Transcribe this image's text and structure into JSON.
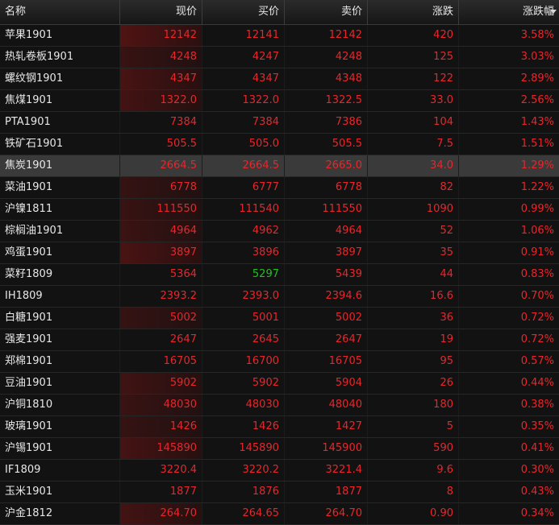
{
  "columns": [
    "名称",
    "现价",
    "买价",
    "卖价",
    "涨跌",
    "涨跌幅"
  ],
  "sorted_column": "涨跌幅",
  "colors": {
    "up": "#e8262b",
    "down": "#1fc21f",
    "flash": "#5a1010"
  },
  "rows": [
    {
      "name": "苹果1901",
      "last": "12142",
      "bid": "12141",
      "ask": "12142",
      "chg": "420",
      "pct": "3.58%",
      "flash": 0.95
    },
    {
      "name": "热轧卷板1901",
      "last": "4248",
      "bid": "4247",
      "ask": "4248",
      "chg": "125",
      "pct": "3.03%",
      "flash": 0.35
    },
    {
      "name": "螺纹钢1901",
      "last": "4347",
      "bid": "4347",
      "ask": "4348",
      "chg": "122",
      "pct": "2.89%",
      "flash": 0.75
    },
    {
      "name": "焦煤1901",
      "last": "1322.0",
      "bid": "1322.0",
      "ask": "1322.5",
      "chg": "33.0",
      "pct": "2.56%",
      "flash": 0.65
    },
    {
      "name": "PTA1901",
      "last": "7384",
      "bid": "7384",
      "ask": "7386",
      "chg": "104",
      "pct": "1.43%",
      "flash": 0
    },
    {
      "name": "铁矿石1901",
      "last": "505.5",
      "bid": "505.0",
      "ask": "505.5",
      "chg": "7.5",
      "pct": "1.51%",
      "flash": 0
    },
    {
      "name": "焦炭1901",
      "last": "2664.5",
      "bid": "2664.5",
      "ask": "2665.0",
      "chg": "34.0",
      "pct": "1.29%",
      "flash": 0,
      "selected": true
    },
    {
      "name": "菜油1901",
      "last": "6778",
      "bid": "6777",
      "ask": "6778",
      "chg": "82",
      "pct": "1.22%",
      "flash": 0.3
    },
    {
      "name": "沪镍1811",
      "last": "111550",
      "bid": "111540",
      "ask": "111550",
      "chg": "1090",
      "pct": "0.99%",
      "flash": 0.35
    },
    {
      "name": "棕榈油1901",
      "last": "4964",
      "bid": "4962",
      "ask": "4964",
      "chg": "52",
      "pct": "1.06%",
      "flash": 0.45
    },
    {
      "name": "鸡蛋1901",
      "last": "3897",
      "bid": "3896",
      "ask": "3897",
      "chg": "35",
      "pct": "0.91%",
      "flash": 0.8
    },
    {
      "name": "菜籽1809",
      "last": "5364",
      "bid": "5297",
      "ask": "5439",
      "chg": "44",
      "pct": "0.83%",
      "flash": 0,
      "bid_down": true
    },
    {
      "name": "IH1809",
      "last": "2393.2",
      "bid": "2393.0",
      "ask": "2394.6",
      "chg": "16.6",
      "pct": "0.70%",
      "flash": 0
    },
    {
      "name": "白糖1901",
      "last": "5002",
      "bid": "5001",
      "ask": "5002",
      "chg": "36",
      "pct": "0.72%",
      "flash": 0.3
    },
    {
      "name": "强麦1901",
      "last": "2647",
      "bid": "2645",
      "ask": "2647",
      "chg": "19",
      "pct": "0.72%",
      "flash": 0
    },
    {
      "name": "郑棉1901",
      "last": "16705",
      "bid": "16700",
      "ask": "16705",
      "chg": "95",
      "pct": "0.57%",
      "flash": 0
    },
    {
      "name": "豆油1901",
      "last": "5902",
      "bid": "5902",
      "ask": "5904",
      "chg": "26",
      "pct": "0.44%",
      "flash": 0.55
    },
    {
      "name": "沪铜1810",
      "last": "48030",
      "bid": "48030",
      "ask": "48040",
      "chg": "180",
      "pct": "0.38%",
      "flash": 0.4
    },
    {
      "name": "玻璃1901",
      "last": "1426",
      "bid": "1426",
      "ask": "1427",
      "chg": "5",
      "pct": "0.35%",
      "flash": 0.3
    },
    {
      "name": "沪锡1901",
      "last": "145890",
      "bid": "145890",
      "ask": "145900",
      "chg": "590",
      "pct": "0.41%",
      "flash": 0.7
    },
    {
      "name": "IF1809",
      "last": "3220.4",
      "bid": "3220.2",
      "ask": "3221.4",
      "chg": "9.6",
      "pct": "0.30%",
      "flash": 0
    },
    {
      "name": "玉米1901",
      "last": "1877",
      "bid": "1876",
      "ask": "1877",
      "chg": "8",
      "pct": "0.43%",
      "flash": 0
    },
    {
      "name": "沪金1812",
      "last": "264.70",
      "bid": "264.65",
      "ask": "264.70",
      "chg": "0.90",
      "pct": "0.34%",
      "flash": 0.65
    }
  ]
}
